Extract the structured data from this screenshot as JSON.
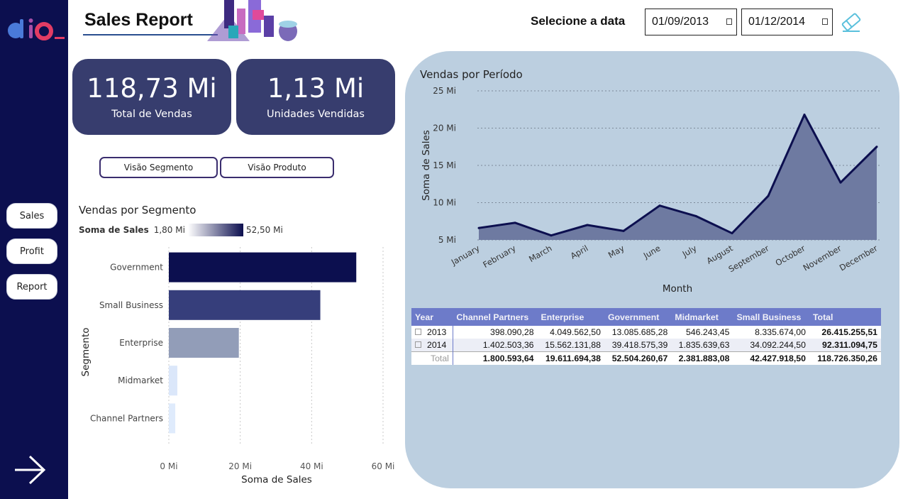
{
  "header": {
    "title": "Sales Report",
    "date_label": "Selecione a data",
    "date_start": "01/09/2013",
    "date_end": "01/12/2014"
  },
  "nav": {
    "items": [
      {
        "label": "Sales",
        "active": true
      },
      {
        "label": "Profit",
        "active": false
      },
      {
        "label": "Report",
        "active": false
      }
    ]
  },
  "kpis": [
    {
      "value": "118,73 Mi",
      "label": "Total de Vendas"
    },
    {
      "value": "1,13 Mi",
      "label": "Unidades Vendidas"
    }
  ],
  "view_buttons": [
    "Visão Segmento",
    "Visão Produto"
  ],
  "segment_legend": {
    "label_bold": "Soma de  Sales",
    "min": "1,80 Mi",
    "max": "52,50 Mi"
  },
  "colors": {
    "sidebar": "#0c0f4f",
    "kpi": "#373d6e",
    "panel": "#bccfe0",
    "area_fill": "#6e7aa1",
    "line": "#0c0f4f",
    "nav_active": "#6d72c9",
    "table_header": "#6d7bc9"
  },
  "chart_data": [
    {
      "type": "bar",
      "orientation": "horizontal",
      "title": "Vendas por Segmento",
      "xlabel": "Soma de Sales",
      "ylabel": "Segmento",
      "categories": [
        "Government",
        "Small Business",
        "Enterprise",
        "Midmarket",
        "Channel Partners"
      ],
      "values": [
        52.5,
        42.43,
        19.61,
        2.38,
        1.8
      ],
      "colors": [
        "#0c0f4f",
        "#363e7b",
        "#929db8",
        "#dbe7fa",
        "#dfebfc"
      ],
      "xticks": [
        "0 Mi",
        "20 Mi",
        "40 Mi",
        "60 Mi"
      ],
      "xlim": [
        0,
        60
      ],
      "grid": true
    },
    {
      "type": "area",
      "title": "Vendas por Período",
      "xlabel": "Month",
      "ylabel": "Soma de Sales",
      "categories": [
        "January",
        "February",
        "March",
        "April",
        "May",
        "June",
        "July",
        "August",
        "September",
        "October",
        "November",
        "December"
      ],
      "values": [
        6.6,
        7.3,
        5.6,
        7.0,
        6.2,
        9.6,
        8.2,
        5.9,
        10.9,
        21.8,
        12.7,
        17.5
      ],
      "yticks": [
        "5 Mi",
        "10 Mi",
        "15 Mi",
        "20 Mi",
        "25 Mi"
      ],
      "ylim": [
        5,
        25
      ],
      "grid": true
    }
  ],
  "table": {
    "columns": [
      "Year",
      "Channel Partners",
      "Enterprise",
      "Government",
      "Midmarket",
      "Small Business",
      "Total"
    ],
    "rows": [
      {
        "year": "2013",
        "values": [
          "398.090,28",
          "4.049.562,50",
          "13.085.685,28",
          "546.243,45",
          "8.335.674,00",
          "26.415.255,51"
        ]
      },
      {
        "year": "2014",
        "values": [
          "1.402.503,36",
          "15.562.131,88",
          "39.418.575,39",
          "1.835.639,63",
          "34.092.244,50",
          "92.311.094,75"
        ]
      }
    ],
    "total": {
      "label": "Total",
      "values": [
        "1.800.593,64",
        "19.611.694,38",
        "52.504.260,67",
        "2.381.883,08",
        "42.427.918,50",
        "118.726.350,26"
      ]
    }
  }
}
